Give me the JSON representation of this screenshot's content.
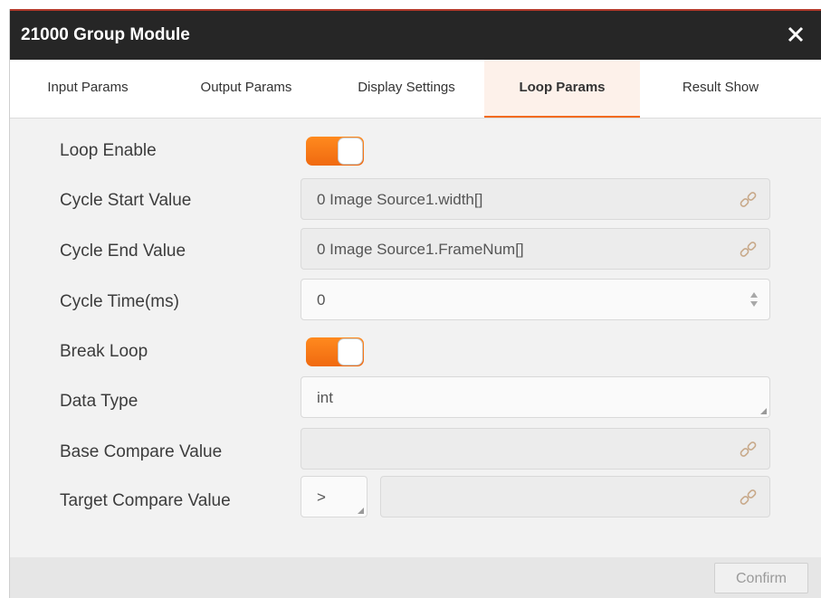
{
  "window": {
    "title": "21000 Group Module"
  },
  "tabs": [
    {
      "label": "Input Params"
    },
    {
      "label": "Output Params"
    },
    {
      "label": "Display Settings"
    },
    {
      "label": "Loop Params",
      "active": true
    },
    {
      "label": "Result Show"
    }
  ],
  "form": {
    "loop_enable": {
      "label": "Loop Enable",
      "on": true
    },
    "cycle_start": {
      "label": "Cycle Start Value",
      "value": "0 Image Source1.width[]"
    },
    "cycle_end": {
      "label": "Cycle End Value",
      "value": "0 Image Source1.FrameNum[]"
    },
    "cycle_time": {
      "label": "Cycle Time(ms)",
      "value": "0"
    },
    "break_loop": {
      "label": "Break Loop",
      "on": true
    },
    "data_type": {
      "label": "Data Type",
      "value": "int"
    },
    "base_compare": {
      "label": "Base Compare Value",
      "value": ""
    },
    "target_compare": {
      "label": "Target Compare Value",
      "operator": ">",
      "value": ""
    }
  },
  "footer": {
    "confirm_label": "Confirm"
  },
  "colors": {
    "accent": "#f26b1d",
    "titlebar": "#262626",
    "panel": "#f2f2f2"
  },
  "icons": [
    "close-icon",
    "link-icon",
    "spinner-icon",
    "dropdown-corner-icon"
  ]
}
